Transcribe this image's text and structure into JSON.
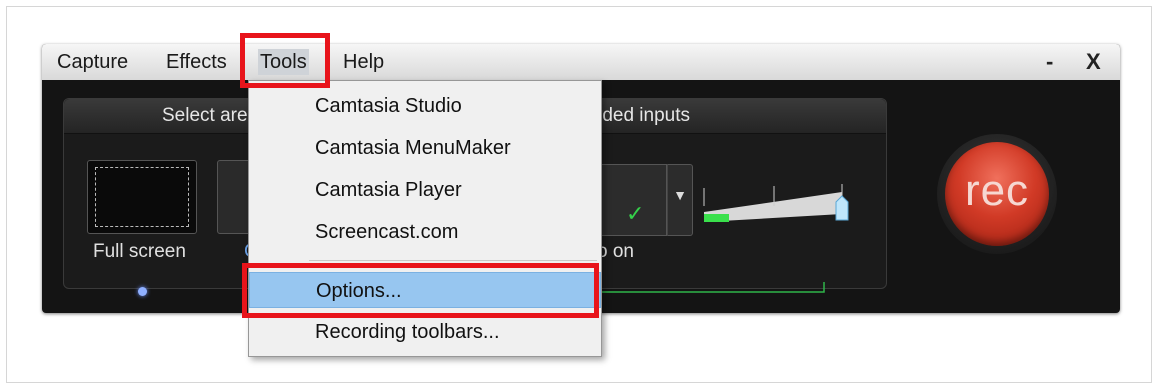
{
  "menubar": {
    "items": [
      "Capture",
      "Effects",
      "Tools",
      "Help"
    ],
    "minimize_label": "-",
    "close_label": "X"
  },
  "panel": {
    "select_area_header": "Select are",
    "recorded_inputs_header": "rded inputs",
    "full_screen_label": "Full screen",
    "custom_label_fragment": "C",
    "audio_label_fragment": "o on"
  },
  "audio": {
    "check_glyph": "✓",
    "dropdown_glyph": "▼",
    "volume_level": 0.18
  },
  "rec_button": {
    "label": "rec"
  },
  "tools_menu": {
    "items": [
      "Camtasia Studio",
      "Camtasia MenuMaker",
      "Camtasia Player",
      "Screencast.com",
      "Options...",
      "Recording toolbars..."
    ],
    "selected": "Options..."
  },
  "highlight_color": "#e8141b",
  "selection_color": "#97c6f0"
}
